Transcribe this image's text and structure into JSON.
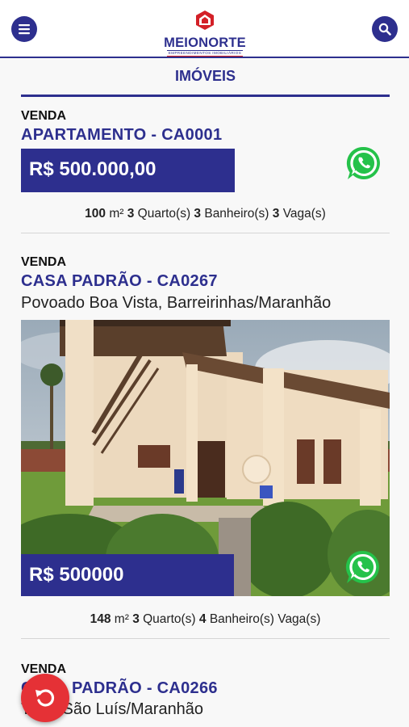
{
  "header": {
    "logo_text": "MEIONORTE",
    "logo_subtext": "EMPREENDIMENTOS IMOBILIÁRIOS",
    "menu_icon": "hamburger-menu-icon",
    "search_icon": "search-icon",
    "brand_color": "#2d2f8e",
    "accent_color": "#d32027"
  },
  "page": {
    "section_title": "IMÓVEIS"
  },
  "listings": [
    {
      "tag": "VENDA",
      "title": "APARTAMENTO - CA0001",
      "price": "R$ 500.000,00",
      "details": {
        "area": "100",
        "area_unit": " m² ",
        "bedrooms": "3",
        "bedrooms_label": " Quarto(s) ",
        "bathrooms": "3",
        "bathrooms_label": " Banheiro(s) ",
        "parking": "3",
        "parking_label": " Vaga(s)"
      }
    },
    {
      "tag": "VENDA",
      "title": "CASA PADRÃO - CA0267",
      "location": "Povoado Boa Vista, Barreirinhas/Maranhão",
      "price": "R$ 500000",
      "details": {
        "area": "148",
        "area_unit": " m² ",
        "bedrooms": "3",
        "bedrooms_label": " Quarto(s) ",
        "bathrooms": "4",
        "bathrooms_label": " Banheiro(s) ",
        "parking_label": " Vaga(s)"
      }
    },
    {
      "tag": "VENDA",
      "title": "CASA PADRÃO - CA0266",
      "location": "Turu, São Luís/Maranhão"
    }
  ],
  "fab": {
    "icon": "undo-icon",
    "color": "#e53136"
  },
  "whatsapp_icon": "whatsapp-icon",
  "whatsapp_color": "#25c24a"
}
